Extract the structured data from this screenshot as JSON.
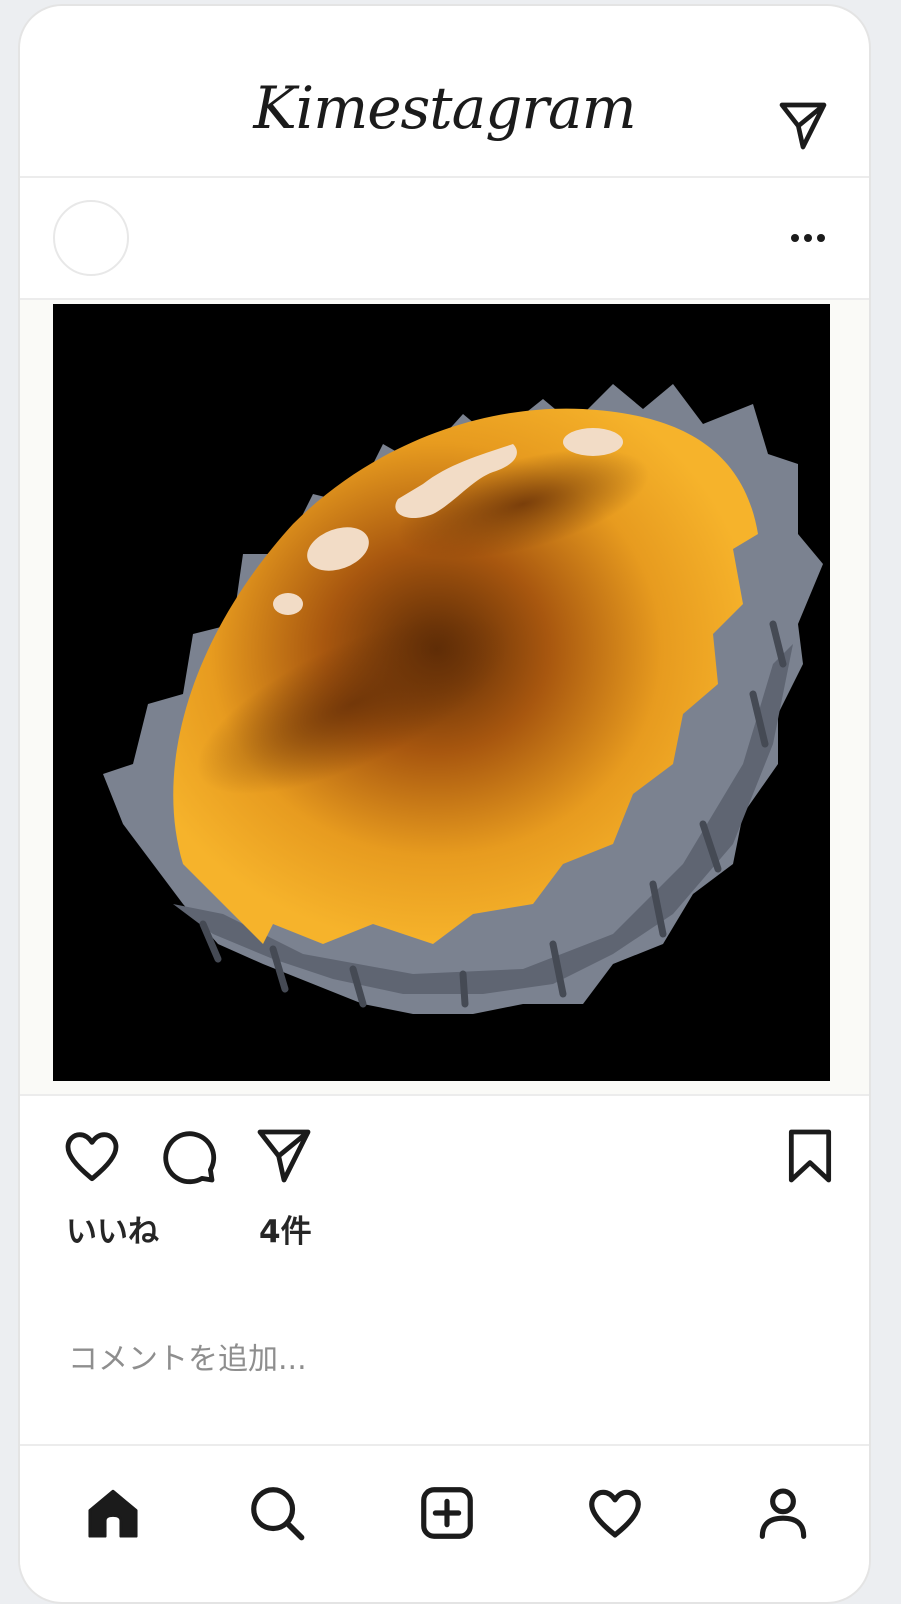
{
  "app": {
    "logo": "Kimestagram"
  },
  "post": {
    "username": "",
    "likes_label": "いいね",
    "likes_count": "4件",
    "caption": ""
  },
  "comment": {
    "placeholder": "コメントを追加..."
  },
  "icons": {
    "direct": "paper-plane-icon",
    "more": "more-horizontal-icon",
    "like": "heart-icon",
    "comment": "comment-bubble-icon",
    "share": "paper-plane-icon",
    "save": "bookmark-icon",
    "home": "home-icon",
    "search": "search-icon",
    "add": "add-post-icon",
    "activity": "heart-icon",
    "profile": "profile-icon"
  },
  "colors": {
    "text": "#262626",
    "placeholder": "#8e8e8e",
    "photo_bg": "#000000"
  }
}
